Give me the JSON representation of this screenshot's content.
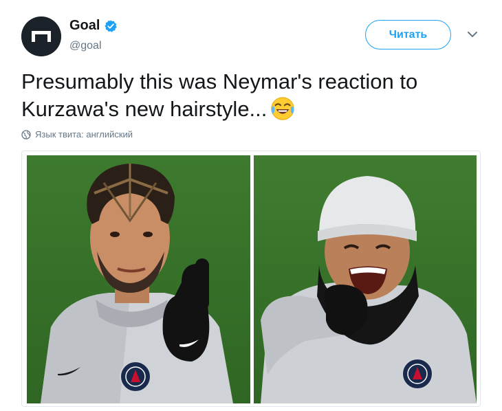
{
  "author": {
    "name": "Goal",
    "handle": "@goal",
    "verified": true
  },
  "icons": {
    "avatar": "goal-logo-icon",
    "verified": "verified-badge-icon",
    "caret": "chevron-down-icon",
    "language": "globe-icon",
    "emoji": "face-with-tears-of-joy-icon"
  },
  "follow_button": {
    "label": "Читать"
  },
  "tweet": {
    "text": "Presumably this was Neymar's reaction to Kurzawa's new hairstyle...",
    "language_note": "Язык твита: английский"
  },
  "colors": {
    "accent": "#1da1f2",
    "text": "#14171a",
    "secondary_text": "#657786",
    "avatar_bg": "#1c2229"
  }
}
